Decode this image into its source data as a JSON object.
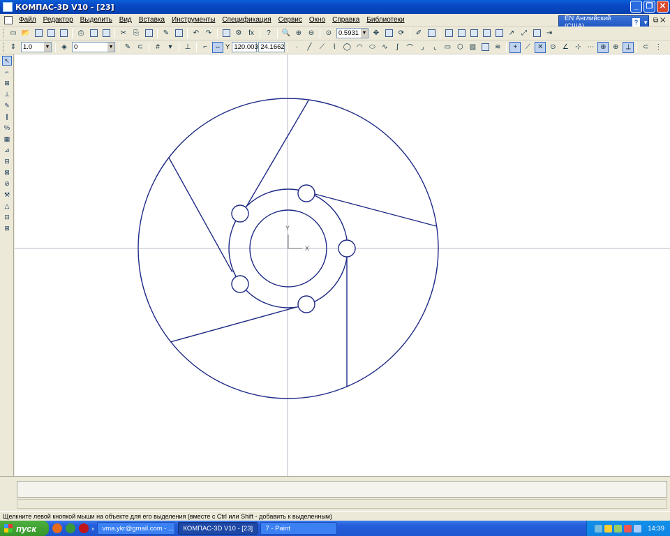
{
  "window": {
    "title": "КОМПАС-3D V10 - [23]"
  },
  "menu": [
    "Файл",
    "Редактор",
    "Выделить",
    "Вид",
    "Вставка",
    "Инструменты",
    "Спецификация",
    "Сервис",
    "Окно",
    "Справка",
    "Библиотеки"
  ],
  "language_bar": {
    "label": "EN Английский (США)",
    "help": "?"
  },
  "toolbar1": {
    "zoom_value": "0.5931"
  },
  "toolbar2": {
    "step_value": "1.0",
    "layer_value": "0",
    "coord_x": "120.003",
    "coord_y": "24.1662"
  },
  "canvas": {
    "axis_label_y": "Y",
    "axis_label_x": "X",
    "colors": {
      "drawing": "#1f2a86",
      "axis": "#b9b9c8"
    }
  },
  "status": {
    "hint": "Щелкните левой кнопкой мыши на объекте для его выделения (вместе с Ctrl или Shift - добавить к выделенным)"
  },
  "taskbar": {
    "start_label": "пуск",
    "tasks": [
      "vma.ykr@gmail.com - ...",
      "КОМПАС-3D V10 - [23]",
      "7 - Paint"
    ],
    "clock": "14:39"
  }
}
